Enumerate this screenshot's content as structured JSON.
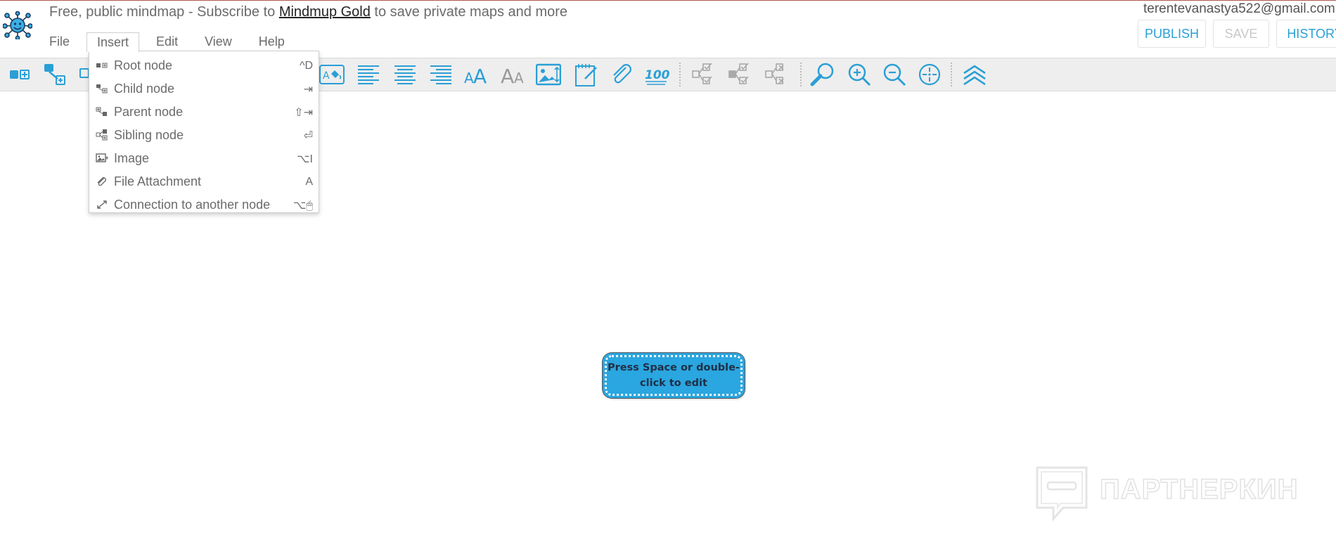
{
  "header": {
    "banner_prefix": "Free, public mindmap - Subscribe to ",
    "banner_link": "Mindmup Gold",
    "banner_suffix": " to save private maps and more",
    "user_email": "terentevanastya522@gmail.com",
    "publish_label": "PUBLISH",
    "save_label": "SAVE",
    "history_label": "HISTORY"
  },
  "menubar": {
    "items": [
      {
        "label": "File"
      },
      {
        "label": "Insert"
      },
      {
        "label": "Edit"
      },
      {
        "label": "View"
      },
      {
        "label": "Help"
      }
    ],
    "active": "Insert"
  },
  "insert_menu": {
    "items": [
      {
        "label": "Root node",
        "shortcut": "^D",
        "icon": "root-node-icon"
      },
      {
        "label": "Child node",
        "shortcut": "⇥",
        "icon": "child-node-icon"
      },
      {
        "label": "Parent node",
        "shortcut": "⇧⇥",
        "icon": "parent-node-icon"
      },
      {
        "label": "Sibling node",
        "shortcut": "⏎",
        "icon": "sibling-node-icon"
      },
      {
        "label": "Image",
        "shortcut": "⌥I",
        "icon": "image-icon"
      },
      {
        "label": "File Attachment",
        "shortcut": "A",
        "icon": "paperclip-icon"
      },
      {
        "label": "Connection to another node",
        "shortcut": "⌥🖱",
        "icon": "connection-icon"
      }
    ]
  },
  "toolbar": {
    "icons": [
      "add-root-node-icon",
      "add-child-node-icon",
      "node-style-icon",
      "text-color-icon",
      "align-left-icon",
      "align-center-icon",
      "align-right-icon",
      "increase-font-icon",
      "decrease-font-icon",
      "insert-image-icon",
      "notes-icon",
      "attachment-icon",
      "progress-score-icon",
      "task-status-icon",
      "task-status-child-icon",
      "task-status-clear-icon",
      "search-icon",
      "zoom-in-icon",
      "zoom-out-icon",
      "reset-view-icon",
      "collapse-all-icon"
    ],
    "font_glyph_large": "AA",
    "font_glyph_small": "AA",
    "text_color_glyph": "A",
    "score_glyph": "100"
  },
  "canvas": {
    "node_text": "Press Space or double-click to edit"
  },
  "watermark": {
    "text": "ПАРТНЕРКИН"
  },
  "colors": {
    "accent": "#2a9fd6",
    "node_fill": "#2aa6e0",
    "toolbar_bg": "#eeeeee"
  }
}
